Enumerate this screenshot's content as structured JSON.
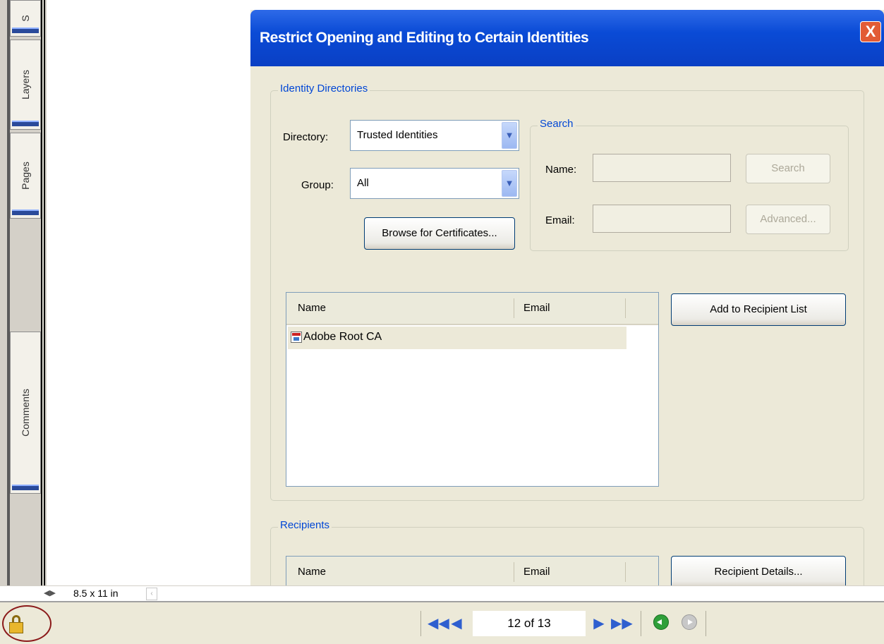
{
  "nav_panel": {
    "tabs": [
      "S",
      "Layers",
      "Pages",
      "Comments"
    ]
  },
  "dialog": {
    "title": "Restrict Opening and Editing to Certain Identities",
    "close_glyph": "X",
    "identity_directories": {
      "legend": "Identity Directories",
      "directory_label": "Directory:",
      "directory_value": "Trusted Identities",
      "group_label": "Group:",
      "group_value": "All",
      "browse_button": "Browse for Certificates..."
    },
    "search": {
      "legend": "Search",
      "name_label": "Name:",
      "email_label": "Email:",
      "search_button": "Search",
      "advanced_button": "Advanced..."
    },
    "identities_list": {
      "columns": [
        "Name",
        "Email"
      ],
      "rows": [
        {
          "name": "Adobe Root CA",
          "email": ""
        }
      ]
    },
    "add_button": "Add to Recipient List",
    "recipients": {
      "legend": "Recipients",
      "columns": [
        "Name",
        "Email"
      ],
      "details_button": "Recipient Details..."
    }
  },
  "page_size": "8.5 x 11 in",
  "status_bar": {
    "page_indicator": "12 of 13"
  },
  "icons": {
    "first_page": "first-page-icon",
    "prev_page": "prev-page-icon",
    "next_page": "next-page-icon",
    "last_page": "last-page-icon",
    "back": "go-back-icon",
    "forward": "go-forward-icon",
    "security": "security-lock-icon"
  },
  "colors": {
    "title_bar": "#0a4bd6",
    "close_button": "#e25b35",
    "legend_text": "#0046d5",
    "dialog_bg": "#ece9d8"
  }
}
